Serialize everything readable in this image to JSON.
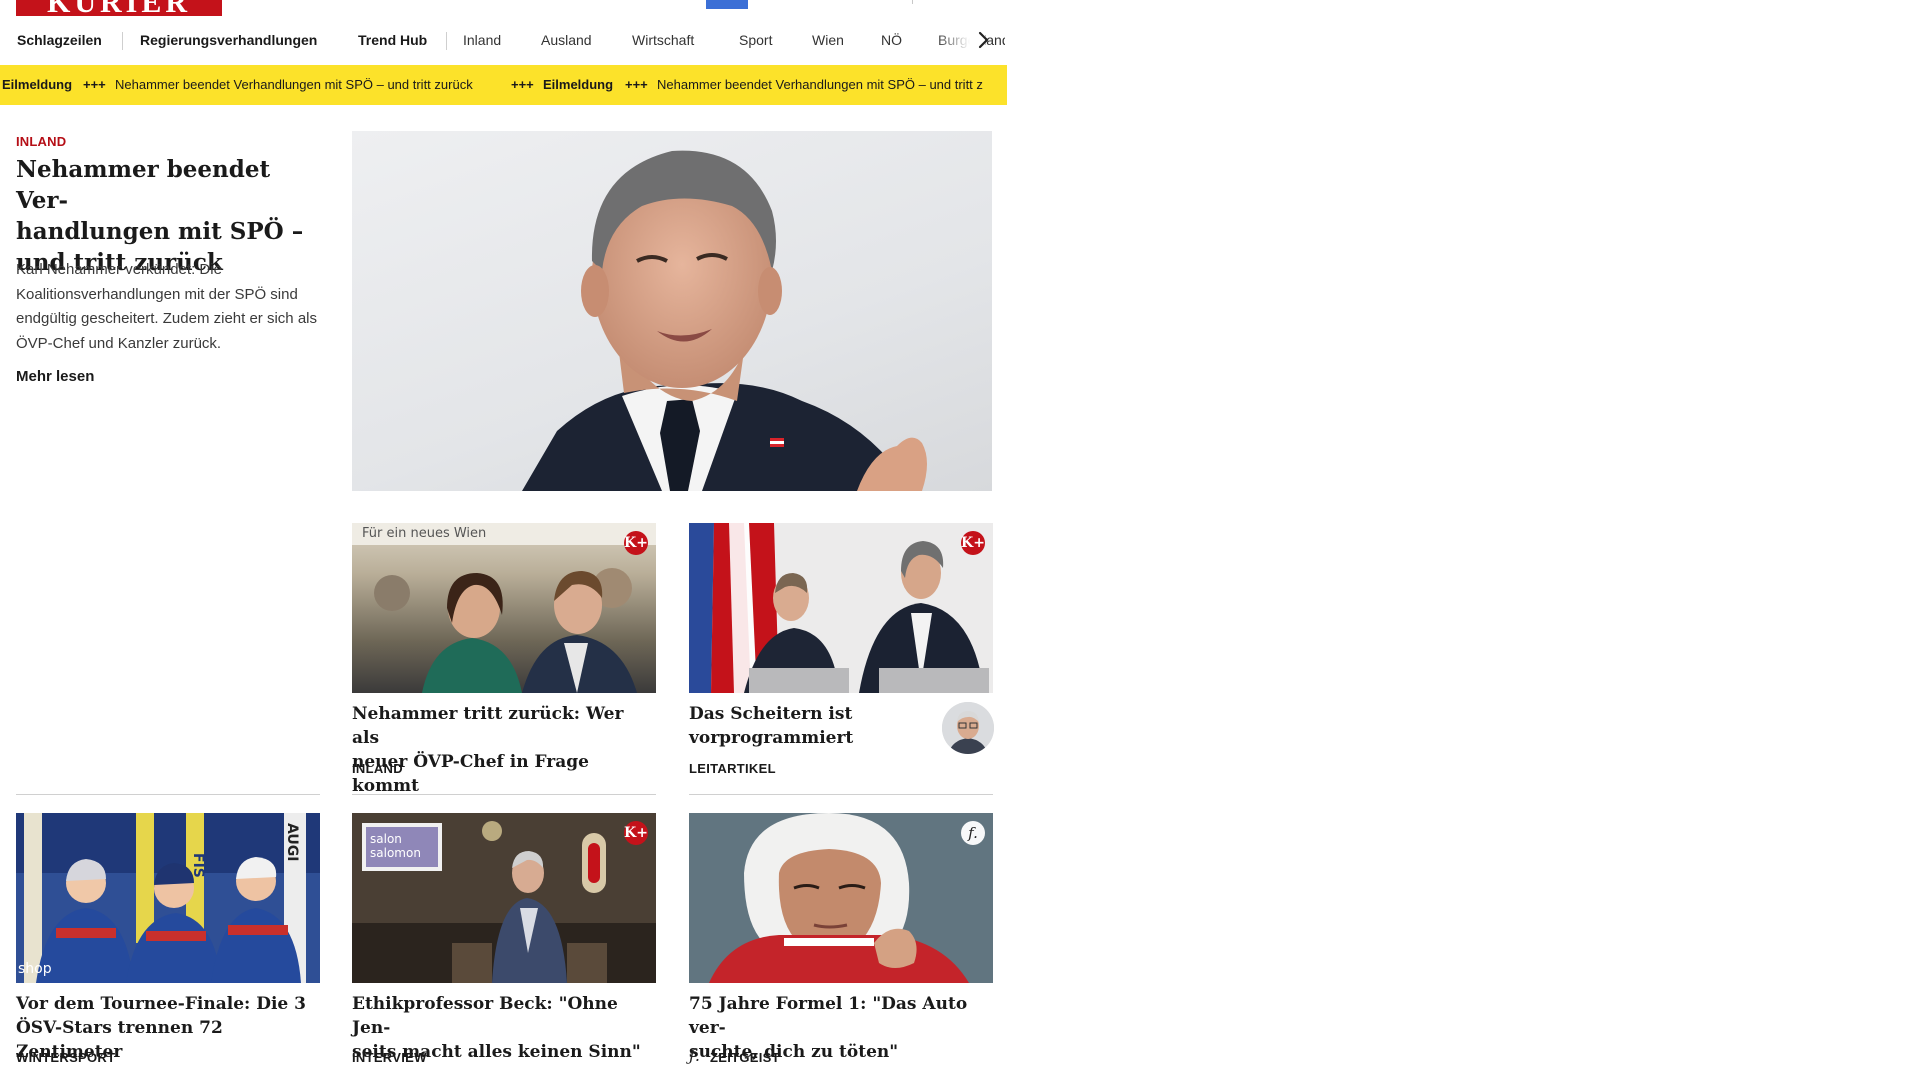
{
  "header": {
    "logo_text": "KURIER",
    "logo_color": "#c4121a"
  },
  "nav": {
    "items": [
      {
        "label": "Schlagzeilen"
      },
      {
        "label": "Regierungsverhandlungen"
      },
      {
        "label": "Trend Hub"
      },
      {
        "label": "Inland"
      },
      {
        "label": "Ausland"
      },
      {
        "label": "Wirtschaft"
      },
      {
        "label": "Sport"
      },
      {
        "label": "Wien"
      },
      {
        "label": "NÖ"
      },
      {
        "label": "Burgenland"
      }
    ],
    "next_icon": "chevron-right-icon"
  },
  "ticker": {
    "label": "Eilmeldung",
    "separator": "+++",
    "text": "Nehammer beendet Verhandlungen mit SPÖ – und tritt zurück",
    "text_clipped": "Nehammer beendet Verhandlungen mit SPÖ – und tritt z",
    "background": "#fce22a"
  },
  "lead": {
    "category": "INLAND",
    "title": "Nehammer beendet Verhandlungen mit SPÖ – und tritt zurück",
    "title_lines": [
      "Nehammer beendet Ver-",
      "handlungen mit SPÖ –",
      "und tritt zurück"
    ],
    "text": "Karl Nehammer verkündet: Die Koalitionsverhandlungen mit der SPÖ sind endgültig gescheitert. Zudem zieht er sich als ÖVP-Chef und Kanzler zurück.",
    "more": "Mehr lesen"
  },
  "cards": [
    {
      "title": "Nehammer tritt zurück: Wer als neuer ÖVP-Chef in Frage kommt",
      "category": "INLAND",
      "badge": "K+"
    },
    {
      "title": "Das Scheitern ist vorprogrammiert",
      "category": "LEITARTIKEL",
      "badge": "K+"
    },
    {
      "title": "Vor dem Tournee-Finale: Die 3 ÖSV-Stars trennen 72 Zentimeter",
      "category": "WINTERSPORT",
      "badge": ""
    },
    {
      "title": "Ethikprofessor Beck: \"Ohne Jenseits macht alles keinen Sinn\"",
      "category": "INTERVIEW",
      "badge": "K+"
    },
    {
      "title": "75 Jahre Formel 1: \"Das Auto versuchte, dich zu töten\"",
      "category": "ZEITGEIST",
      "badge": "f."
    }
  ],
  "card_titles_display": [
    [
      "Nehammer tritt zurück: Wer als",
      "neuer ÖVP-Chef in Frage kommt"
    ],
    [
      "Das Scheitern ist",
      "vorprogrammiert"
    ],
    [
      "Vor dem Tournee-Finale: Die 3",
      "ÖSV-Stars trennen 72 Zentimeter"
    ],
    [
      "Ethikprofessor Beck: \"Ohne Jen-",
      "seits macht alles keinen Sinn\""
    ],
    [
      "75 Jahre Formel 1: \"Das Auto ver-",
      "suchte, dich zu töten\""
    ]
  ],
  "image_texts": {
    "card1_sign": "Für ein neues Wien",
    "card4_logo_1": "salon",
    "card4_logo_2": "salomon",
    "card3_fis": "FIS",
    "card3_augi": "AUGI",
    "card3_shop": "shop"
  },
  "colors": {
    "accent": "#c4121a",
    "category_red": "#b50e16",
    "ticker_yellow": "#fce22a"
  }
}
